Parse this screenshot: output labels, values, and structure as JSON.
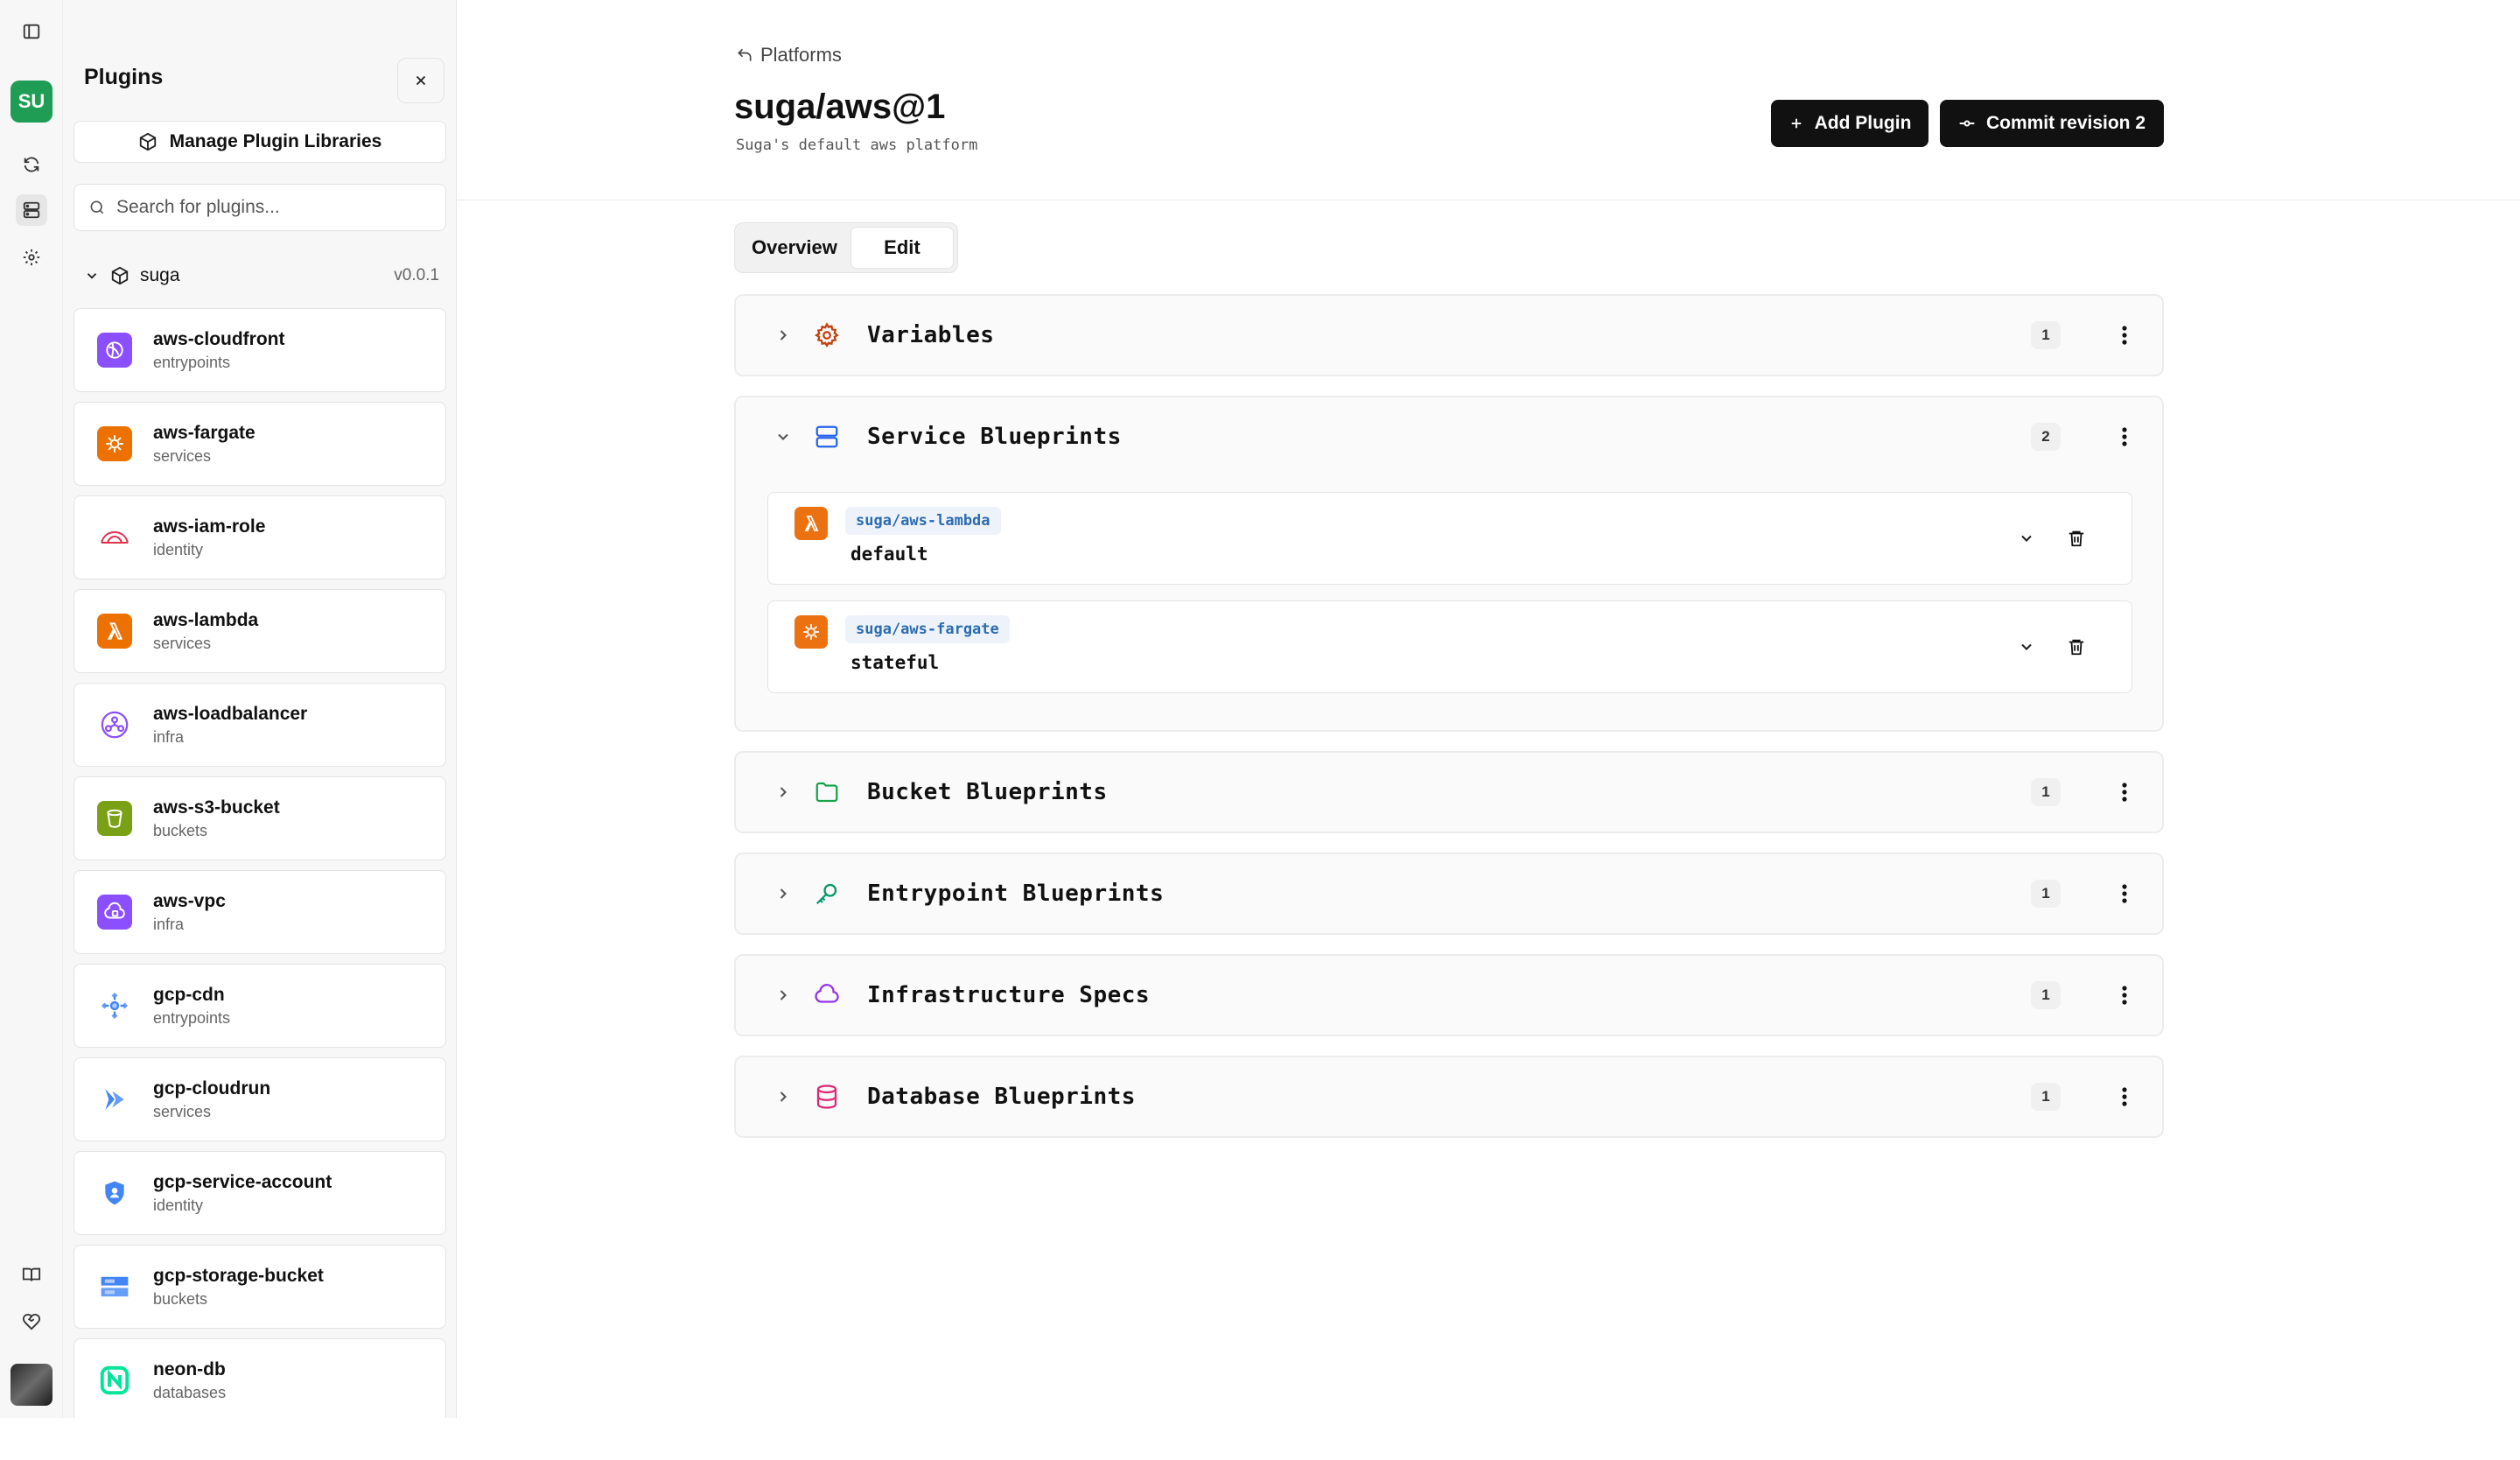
{
  "rail": {
    "workspace_initials": "SU",
    "icons": [
      "sidebar-toggle-icon",
      "sync-icon",
      "platforms-icon",
      "settings-icon",
      "book-icon",
      "heart-handshake-icon"
    ]
  },
  "plugins_panel": {
    "title": "Plugins",
    "manage_label": "Manage Plugin Libraries",
    "search_placeholder": "Search for plugins...",
    "library": {
      "name": "suga",
      "version": "v0.0.1"
    },
    "items": [
      {
        "name": "aws-cloudfront",
        "category": "entrypoints",
        "icon": "aws-cloudfront-icon",
        "color": "#8c4fff"
      },
      {
        "name": "aws-fargate",
        "category": "services",
        "icon": "aws-fargate-icon",
        "color": "#ed7100"
      },
      {
        "name": "aws-iam-role",
        "category": "identity",
        "icon": "aws-iam-role-icon",
        "color": "#dd344c"
      },
      {
        "name": "aws-lambda",
        "category": "services",
        "icon": "aws-lambda-icon",
        "color": "#ed7100"
      },
      {
        "name": "aws-loadbalancer",
        "category": "infra",
        "icon": "aws-loadbalancer-icon",
        "color": "#8c4fff"
      },
      {
        "name": "aws-s3-bucket",
        "category": "buckets",
        "icon": "aws-s3-bucket-icon",
        "color": "#7aa116"
      },
      {
        "name": "aws-vpc",
        "category": "infra",
        "icon": "aws-vpc-icon",
        "color": "#8c4fff"
      },
      {
        "name": "gcp-cdn",
        "category": "entrypoints",
        "icon": "gcp-cdn-icon",
        "color": "#4285f4"
      },
      {
        "name": "gcp-cloudrun",
        "category": "services",
        "icon": "gcp-cloudrun-icon",
        "color": "#4285f4"
      },
      {
        "name": "gcp-service-account",
        "category": "identity",
        "icon": "gcp-service-account-icon",
        "color": "#4285f4"
      },
      {
        "name": "gcp-storage-bucket",
        "category": "buckets",
        "icon": "gcp-storage-bucket-icon",
        "color": "#4285f4"
      },
      {
        "name": "neon-db",
        "category": "databases",
        "icon": "neon-db-icon",
        "color": "#00e599"
      }
    ]
  },
  "header": {
    "back_label": "Platforms",
    "title": "suga/aws@1",
    "subtitle": "Suga's default aws platform",
    "add_plugin_label": "Add Plugin",
    "commit_label": "Commit revision 2"
  },
  "tabs": [
    {
      "label": "Overview",
      "selected": false
    },
    {
      "label": "Edit",
      "selected": true
    }
  ],
  "sections": {
    "variables": {
      "title": "Variables",
      "count": "1",
      "icon": "gear-icon",
      "color": "#c2410c"
    },
    "service": {
      "title": "Service Blueprints",
      "count": "2",
      "icon": "server-icon",
      "color": "#2563eb",
      "blueprints": [
        {
          "plugin": "suga/aws-lambda",
          "name": "default",
          "icon": "aws-lambda-icon"
        },
        {
          "plugin": "suga/aws-fargate",
          "name": "stateful",
          "icon": "aws-fargate-icon"
        }
      ]
    },
    "bucket": {
      "title": "Bucket Blueprints",
      "count": "1",
      "icon": "folder-icon",
      "color": "#16a34a"
    },
    "entrypoint": {
      "title": "Entrypoint Blueprints",
      "count": "1",
      "icon": "key-icon",
      "color": "#059669"
    },
    "infra": {
      "title": "Infrastructure Specs",
      "count": "1",
      "icon": "cloud-icon",
      "color": "#9333ea"
    },
    "database": {
      "title": "Database Blueprints",
      "count": "1",
      "icon": "database-icon",
      "color": "#db2777"
    }
  }
}
